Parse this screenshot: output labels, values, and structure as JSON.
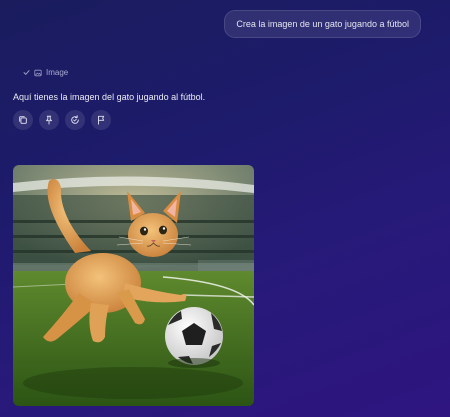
{
  "user_message": "Crea la imagen de un gato jugando a fútbol",
  "tool_status": {
    "label": "Image",
    "icons": [
      "check-icon",
      "image-icon"
    ]
  },
  "assistant": {
    "text": "Aquí tienes la imagen del gato jugando al fútbol.",
    "actions": [
      {
        "name": "copy-button",
        "icon": "copy-icon"
      },
      {
        "name": "pin-button",
        "icon": "pin-icon"
      },
      {
        "name": "regenerate-button",
        "icon": "regenerate-icon"
      },
      {
        "name": "report-button",
        "icon": "flag-icon"
      }
    ]
  },
  "image": {
    "subject": "generated-image"
  },
  "colors": {
    "bg_top": "#1a1c5e",
    "bg_bottom": "#2e1580",
    "bubble": "#3a3a7a",
    "muted": "#a9abd0"
  }
}
